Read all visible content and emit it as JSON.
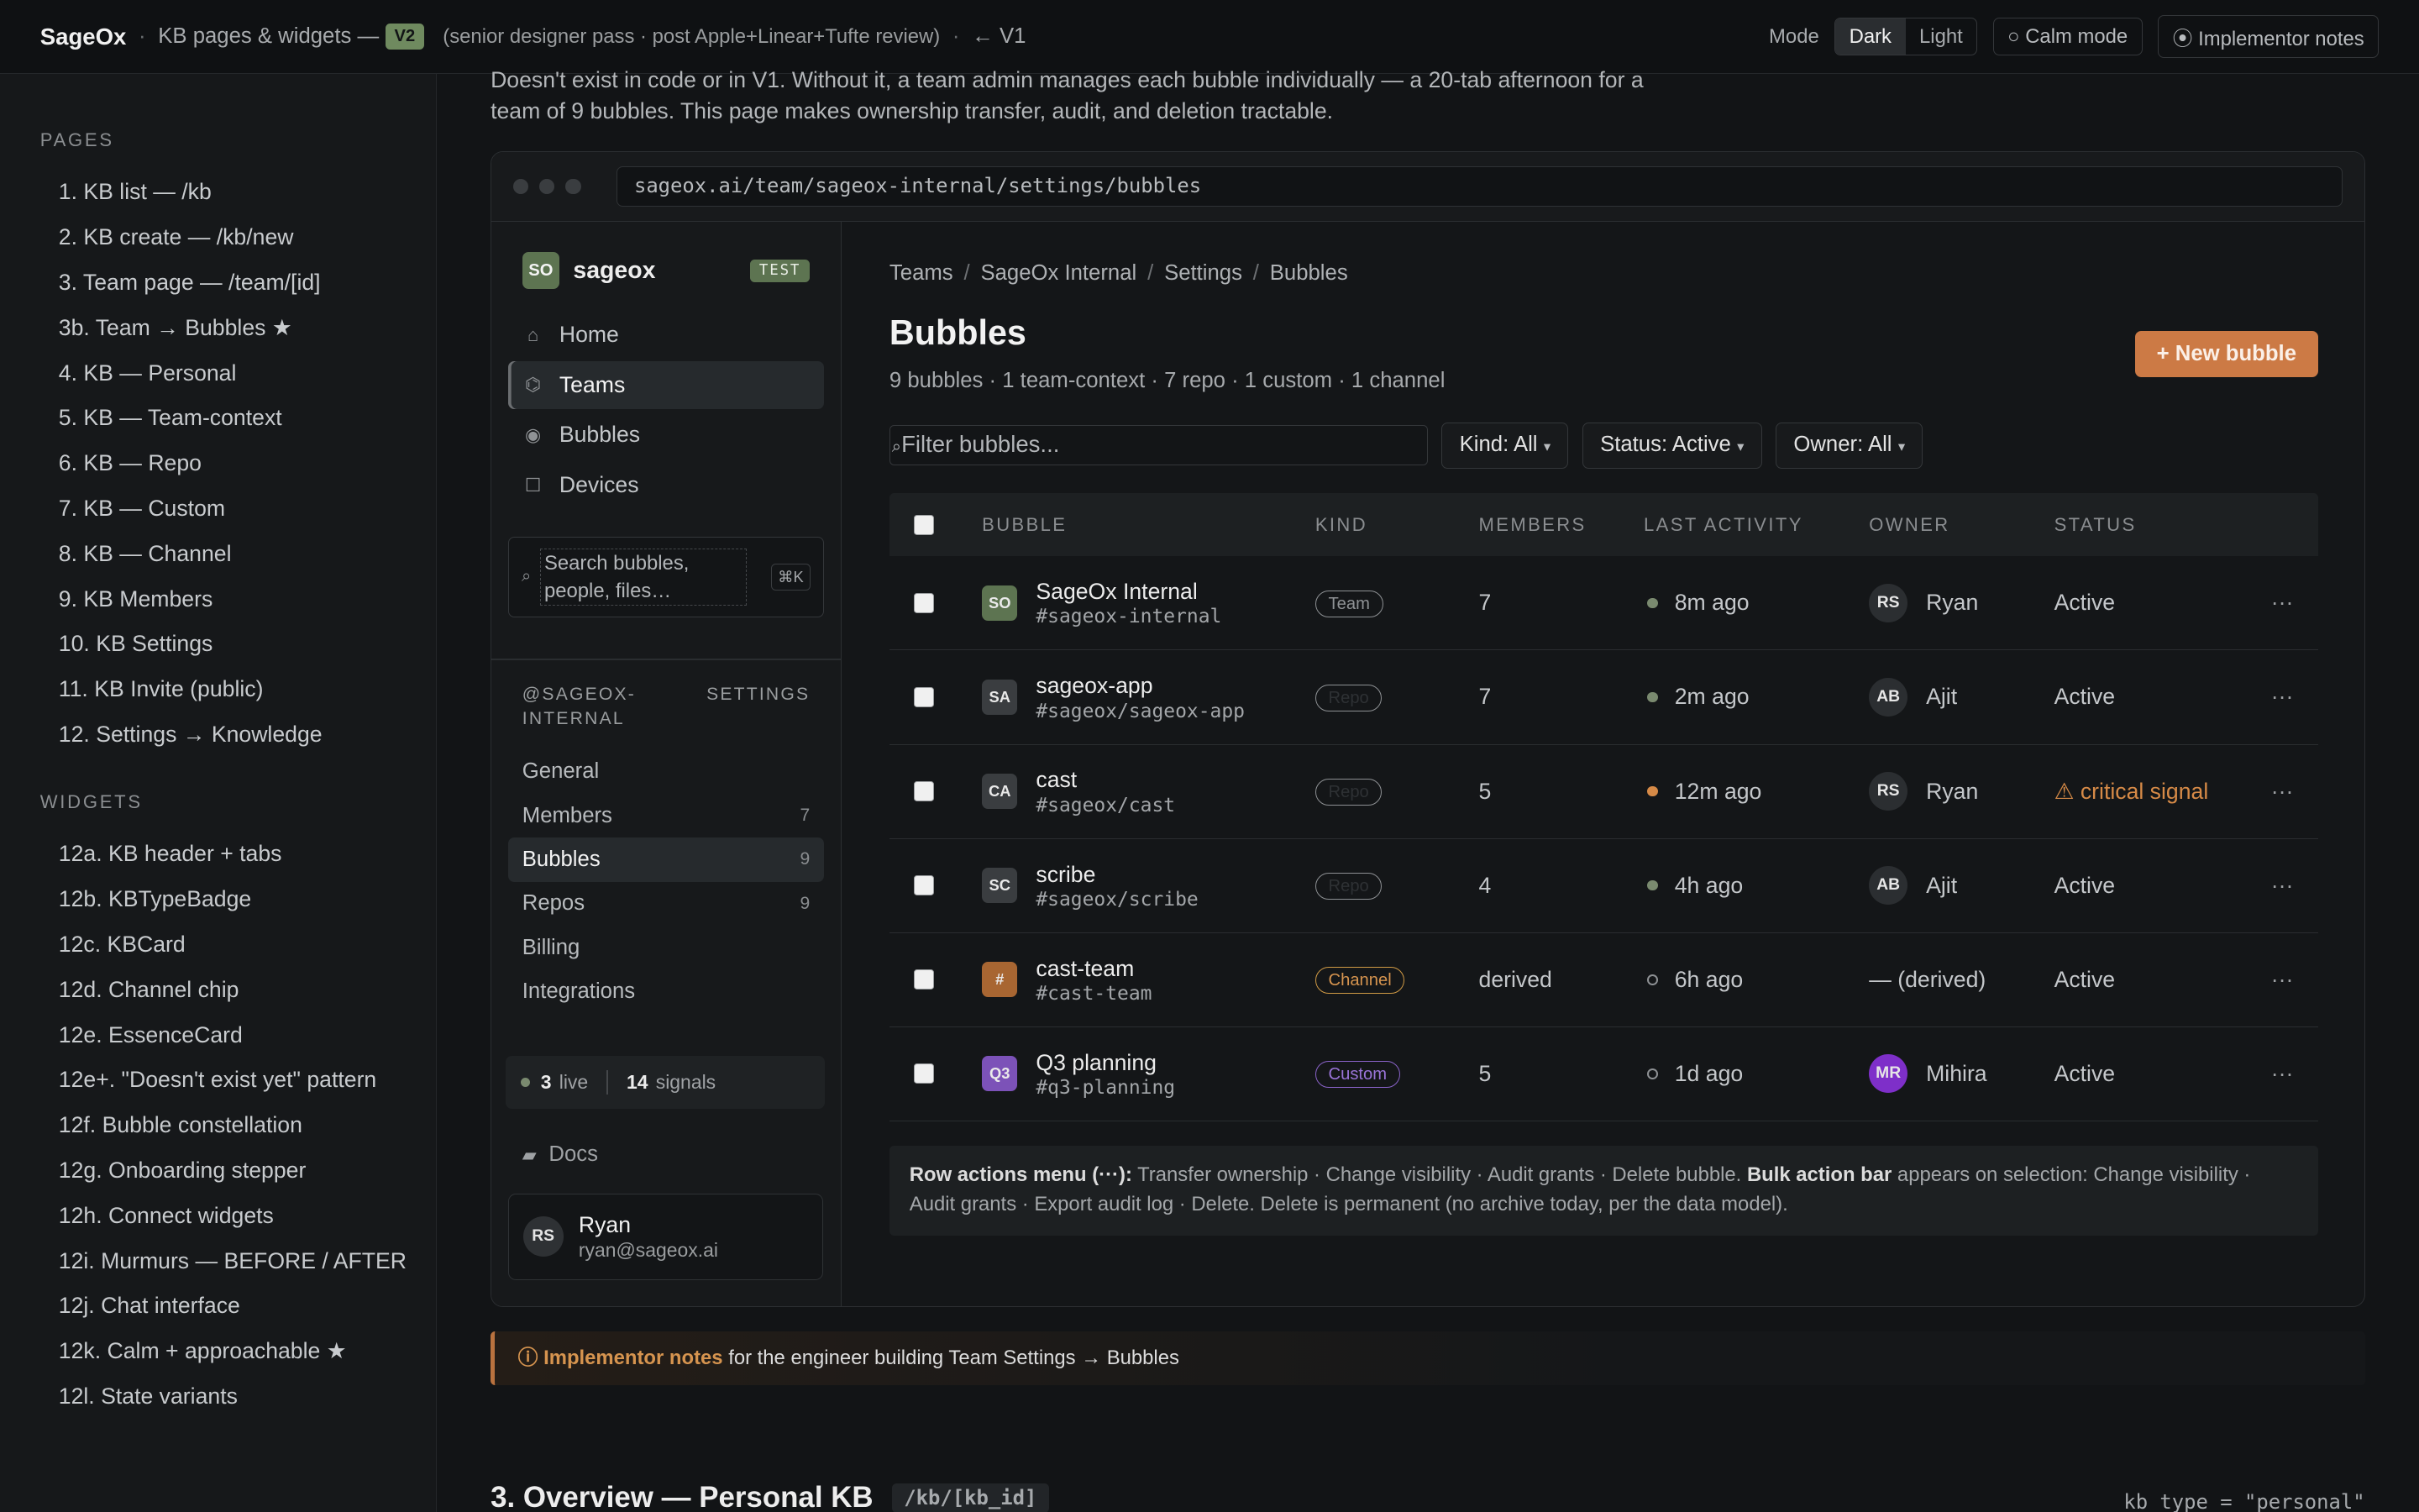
{
  "topbar": {
    "brand": "SageOx",
    "title": "KB pages & widgets —",
    "version": "V2",
    "subtitle": "(senior designer pass · post Apple+Linear+Tufte review)",
    "back_link": "← V1",
    "mode_label": "Mode",
    "mode_dark": "Dark",
    "mode_light": "Light",
    "calm_mode": "○ Calm mode",
    "implementor_notes": "⦿ Implementor notes"
  },
  "leftnav": {
    "pages_heading": "PAGES",
    "pages": [
      "1. KB list — /kb",
      "2. KB create — /kb/new",
      "3. Team page — /team/[id]",
      "3b. Team → Bubbles ★",
      "4. KB — Personal",
      "5. KB — Team-context",
      "6. KB — Repo",
      "7. KB — Custom",
      "8. KB — Channel",
      "9. KB Members",
      "10. KB Settings",
      "11. KB Invite (public)",
      "12. Settings → Knowledge"
    ],
    "widgets_heading": "WIDGETS",
    "widgets": [
      "12a. KB header + tabs",
      "12b. KBTypeBadge",
      "12c. KBCard",
      "12d. Channel chip",
      "12e. EssenceCard",
      "12e+. \"Doesn't exist yet\" pattern",
      "12f. Bubble constellation",
      "12g. Onboarding stepper",
      "12h. Connect widgets",
      "12i. Murmurs — BEFORE / AFTER",
      "12j. Chat interface",
      "12k. Calm + approachable ★",
      "12l. State variants"
    ]
  },
  "intro": "Doesn't exist in code or in V1. Without it, a team admin manages each bubble individually — a 20-tab afternoon for a team of 9 bubbles. This page makes ownership transfer, audit, and deletion tractable.",
  "browser": {
    "url": "sageox.ai/team/sageox-internal/settings/bubbles"
  },
  "app": {
    "workspace_logo": "SO",
    "workspace_name": "sageox",
    "env_badge": "TEST",
    "nav": [
      {
        "icon": "⌂",
        "label": "Home"
      },
      {
        "icon": "⌬",
        "label": "Teams"
      },
      {
        "icon": "◉",
        "label": "Bubbles"
      },
      {
        "icon": "☐",
        "label": "Devices"
      }
    ],
    "search_placeholder": "Search bubbles, people, files…",
    "search_kbd": "⌘K",
    "settings_scope": "@SAGEOX-INTERNAL",
    "settings_label": "SETTINGS",
    "settings_nav": [
      {
        "label": "General",
        "count": ""
      },
      {
        "label": "Members",
        "count": "7"
      },
      {
        "label": "Bubbles",
        "count": "9"
      },
      {
        "label": "Repos",
        "count": "9"
      },
      {
        "label": "Billing",
        "count": ""
      },
      {
        "label": "Integrations",
        "count": ""
      }
    ],
    "live_count": "3",
    "live_label": "live",
    "signals_count": "14",
    "signals_label": "signals",
    "docs_label": "Docs",
    "user_initials": "RS",
    "user_name": "Ryan",
    "user_email": "ryan@sageox.ai"
  },
  "page": {
    "breadcrumb": [
      "Teams",
      "SageOx Internal",
      "Settings",
      "Bubbles"
    ],
    "title": "Bubbles",
    "summary": "9 bubbles · 1 team-context · 7 repo · 1 custom · 1 channel",
    "new_button": "+ New bubble",
    "filter_placeholder": "Filter bubbles...",
    "kind_filter": "Kind: All",
    "status_filter": "Status: Active",
    "owner_filter": "Owner: All",
    "columns": [
      "BUBBLE",
      "KIND",
      "MEMBERS",
      "LAST ACTIVITY",
      "OWNER",
      "STATUS"
    ],
    "rows": [
      {
        "icon": "SO",
        "icon_color": "#5d7451",
        "name": "SageOx Internal",
        "slug": "#sageox-internal",
        "kind": "Team",
        "members": "7",
        "activity": "8m ago",
        "activity_color": "#7a8a6f",
        "owner_initials": "RS",
        "owner_color": "#2b2e31",
        "owner": "Ryan",
        "status": "Active"
      },
      {
        "icon": "SA",
        "icon_color": "#3a3d40",
        "name": "sageox-app",
        "slug": "#sageox/sageox-app",
        "kind": "Repo",
        "members": "7",
        "activity": "2m ago",
        "activity_color": "#7a8a6f",
        "owner_initials": "AB",
        "owner_color": "#2b2e31",
        "owner": "Ajit",
        "status": "Active"
      },
      {
        "icon": "CA",
        "icon_color": "#3a3d40",
        "name": "cast",
        "slug": "#sageox/cast",
        "kind": "Repo",
        "members": "5",
        "activity": "12m ago",
        "activity_color": "#d68a47",
        "owner_initials": "RS",
        "owner_color": "#2b2e31",
        "owner": "Ryan",
        "status": "⚠ critical signal"
      },
      {
        "icon": "SC",
        "icon_color": "#3a3d40",
        "name": "scribe",
        "slug": "#sageox/scribe",
        "kind": "Repo",
        "members": "4",
        "activity": "4h ago",
        "activity_color": "#7a8a6f",
        "owner_initials": "AB",
        "owner_color": "#2b2e31",
        "owner": "Ajit",
        "status": "Active"
      },
      {
        "icon": "#",
        "icon_color": "#a86632",
        "name": "cast-team",
        "slug": "#cast-team",
        "kind": "Channel",
        "members": "derived",
        "activity": "6h ago",
        "activity_color": "",
        "owner_initials": "",
        "owner_color": "",
        "owner": "— (derived)",
        "status": "Active"
      },
      {
        "icon": "Q3",
        "icon_color": "#7c52b8",
        "name": "Q3 planning",
        "slug": "#q3-planning",
        "kind": "Custom",
        "members": "5",
        "activity": "1d ago",
        "activity_color": "",
        "owner_initials": "MR",
        "owner_color": "#7e2fc9",
        "owner": "Mihira",
        "status": "Active"
      }
    ],
    "row_menu": "···",
    "note_b1": "Row actions menu (···):",
    "note_t1": " Transfer ownership · Change visibility · Audit grants · Delete bubble. ",
    "note_b2": "Bulk action bar",
    "note_t2": " appears on selection: Change visibility · Audit grants · Export audit log · Delete. Delete is permanent (no archive today, per the data model)."
  },
  "implementor": {
    "prefix": "ⓘ",
    "label": "Implementor notes",
    "text": " for the engineer building Team Settings → Bubbles"
  },
  "next_section": {
    "title": "3. Overview — Personal KB",
    "route": "/kb/[kb_id]",
    "kb_type": "kb_type = \"personal\""
  }
}
